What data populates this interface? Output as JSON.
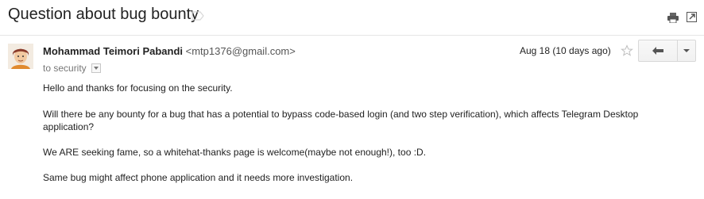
{
  "subject": {
    "title": "Question about bug bounty"
  },
  "header_icons": {
    "label": "label-icon",
    "print": "print-icon",
    "new_window": "new-window-icon"
  },
  "message": {
    "sender_name": "Mohammad Teimori Pabandi",
    "sender_email": "<mtp1376@gmail.com>",
    "to_line": "to security",
    "date": "Aug 18 (10 days ago)",
    "star_icon": "star-icon",
    "reply_icon": "reply-arrow-icon",
    "more_icon": "chevron-down-icon",
    "body": [
      "Hello and thanks for focusing on the security.",
      "Will there be any bounty for a bug that has a potential to bypass code-based login (and two step verification), which affects Telegram Desktop application?",
      "We ARE seeking fame, so a whitehat-thanks page is welcome(maybe not enough!), too :D.",
      "Same bug might affect phone application and it needs more investigation."
    ]
  },
  "colors": {
    "text": "#222222",
    "muted": "#777777",
    "divider": "#e5e5e5"
  }
}
